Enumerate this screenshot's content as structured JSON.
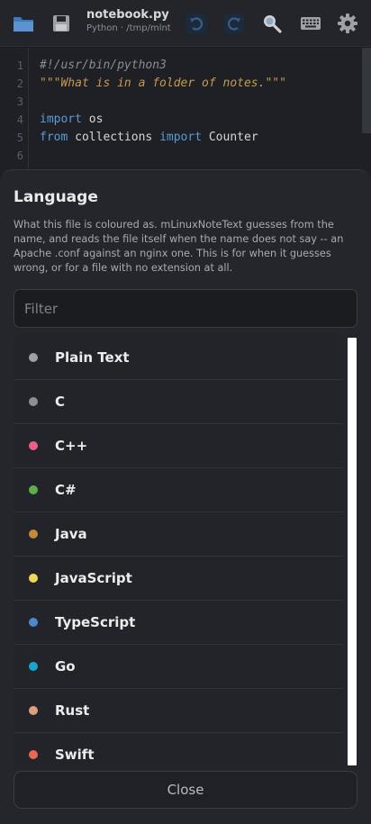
{
  "toolbar": {
    "file_title": "notebook.py",
    "file_subtitle": "Python · /tmp/mlnt",
    "icons": {
      "open": "folder-icon",
      "save": "save-icon",
      "undo": "undo-icon",
      "redo": "redo-icon",
      "search": "search-icon",
      "keyboard": "keyboard-icon",
      "settings": "gear-icon"
    }
  },
  "editor": {
    "line_numbers": [
      "1",
      "2",
      "3",
      "4",
      "5",
      "6"
    ],
    "lines": [
      [
        {
          "t": "#!/usr/bin/python3",
          "c": "comment"
        }
      ],
      [
        {
          "t": "\"\"\"What is in a folder of notes.\"\"\"",
          "c": "string"
        }
      ],
      [],
      [
        {
          "t": "import",
          "c": "kw"
        },
        {
          "t": " os",
          "c": "plain"
        }
      ],
      [
        {
          "t": "from",
          "c": "kw"
        },
        {
          "t": " collections ",
          "c": "plain"
        },
        {
          "t": "import",
          "c": "kw"
        },
        {
          "t": " Counter",
          "c": "plain"
        }
      ],
      []
    ]
  },
  "sheet": {
    "title": "Language",
    "description": "What this file is coloured as. mLinuxNoteText guesses from the name, and reads the file itself when the name does not say -- an Apache .conf against an nginx one. This is for when it guesses wrong, or for a file with no extension at all.",
    "filter_placeholder": "Filter",
    "filter_value": "",
    "languages": [
      {
        "label": "Plain Text",
        "color": "#9ea1a8"
      },
      {
        "label": "C",
        "color": "#8e8f93"
      },
      {
        "label": "C++",
        "color": "#e8608a"
      },
      {
        "label": "C#",
        "color": "#5fae4e"
      },
      {
        "label": "Java",
        "color": "#c48a3c"
      },
      {
        "label": "JavaScript",
        "color": "#efd85a"
      },
      {
        "label": "TypeScript",
        "color": "#4f88c9"
      },
      {
        "label": "Go",
        "color": "#17a6cf"
      },
      {
        "label": "Rust",
        "color": "#dc9f80"
      },
      {
        "label": "Swift",
        "color": "#e8694e"
      }
    ],
    "close_label": "Close"
  }
}
